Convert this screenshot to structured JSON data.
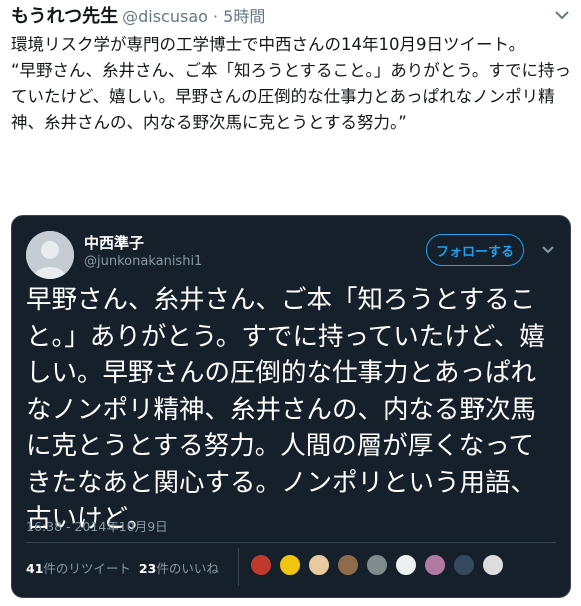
{
  "tweet": {
    "author_name": "もうれつ先生",
    "author_handle": "@discusao · 5時間",
    "text": "環境リスク学が専門の工学博士で中西さんの14年10月9日ツイート。\n“早野さん、糸井さん、ご本「知ろうとすること。」ありがとう。すでに持っていたけど、嬉しい。早野さんの圧倒的な仕事力とあっぱれなノンポリ精神、糸井さんの、内なる野次馬に克とうとする努力。”"
  },
  "quote": {
    "name": "中西準子",
    "handle": "@junkonakanishi1",
    "follow_label": "フォローする",
    "text": "早野さん、糸井さん、ご本「知ろうとすること。」ありがとう。すでに持っていたけど、嬉しい。早野さんの圧倒的な仕事力とあっぱれなノンポリ精神、糸井さんの、内なる野次馬に克とうとする努力。人間の層が厚くなってきたなあと関心する。ノンポリという用語、古いけど。",
    "timestamp": "16:38 - 2014年10月9日",
    "retweet_count": "41",
    "retweet_label": "件のリツイート",
    "like_count": "23",
    "like_label": "件のいいね",
    "liker_colors": [
      "#c0392b",
      "#f1c40f",
      "#e8c9a0",
      "#8e6b4a",
      "#7f8c8d",
      "#ecf0f1",
      "#b07aa1",
      "#34495e",
      "#dddddd"
    ]
  },
  "icons": {
    "tweet_menu": "chevron-down-icon",
    "quote_menu": "chevron-down-icon",
    "avatar": "default-avatar-icon"
  }
}
